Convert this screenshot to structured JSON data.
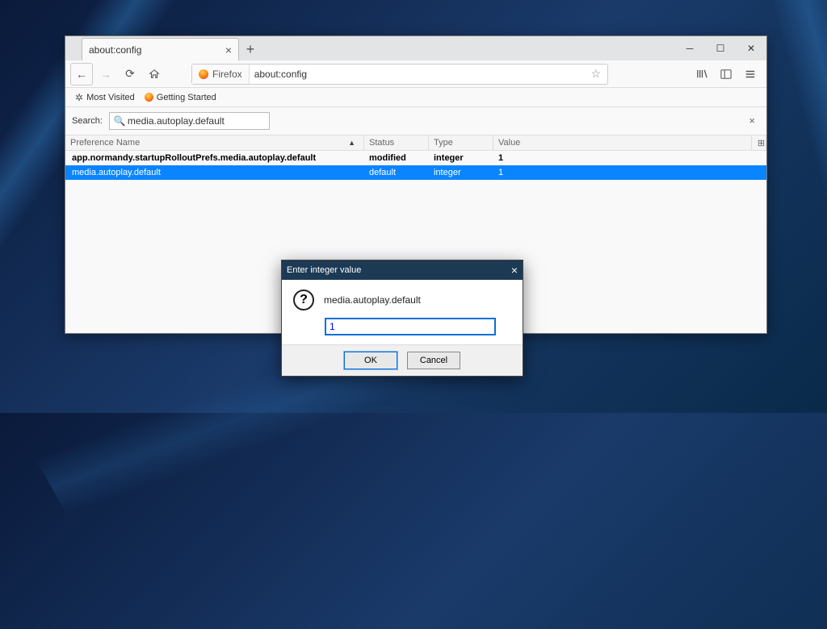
{
  "tab": {
    "title": "about:config"
  },
  "url": {
    "identity": "Firefox",
    "value": "about:config"
  },
  "bookmarks": {
    "mostVisited": "Most Visited",
    "gettingStarted": "Getting Started"
  },
  "search": {
    "label": "Search:",
    "value": "media.autoplay.default"
  },
  "columns": {
    "name": "Preference Name",
    "status": "Status",
    "type": "Type",
    "value": "Value"
  },
  "rows": [
    {
      "name": "app.normandy.startupRolloutPrefs.media.autoplay.default",
      "status": "modified",
      "type": "integer",
      "value": "1",
      "bold": true,
      "selected": false
    },
    {
      "name": "media.autoplay.default",
      "status": "default",
      "type": "integer",
      "value": "1",
      "bold": false,
      "selected": true
    }
  ],
  "dialog": {
    "title": "Enter integer value",
    "pref": "media.autoplay.default",
    "input": "1",
    "ok": "OK",
    "cancel": "Cancel"
  }
}
